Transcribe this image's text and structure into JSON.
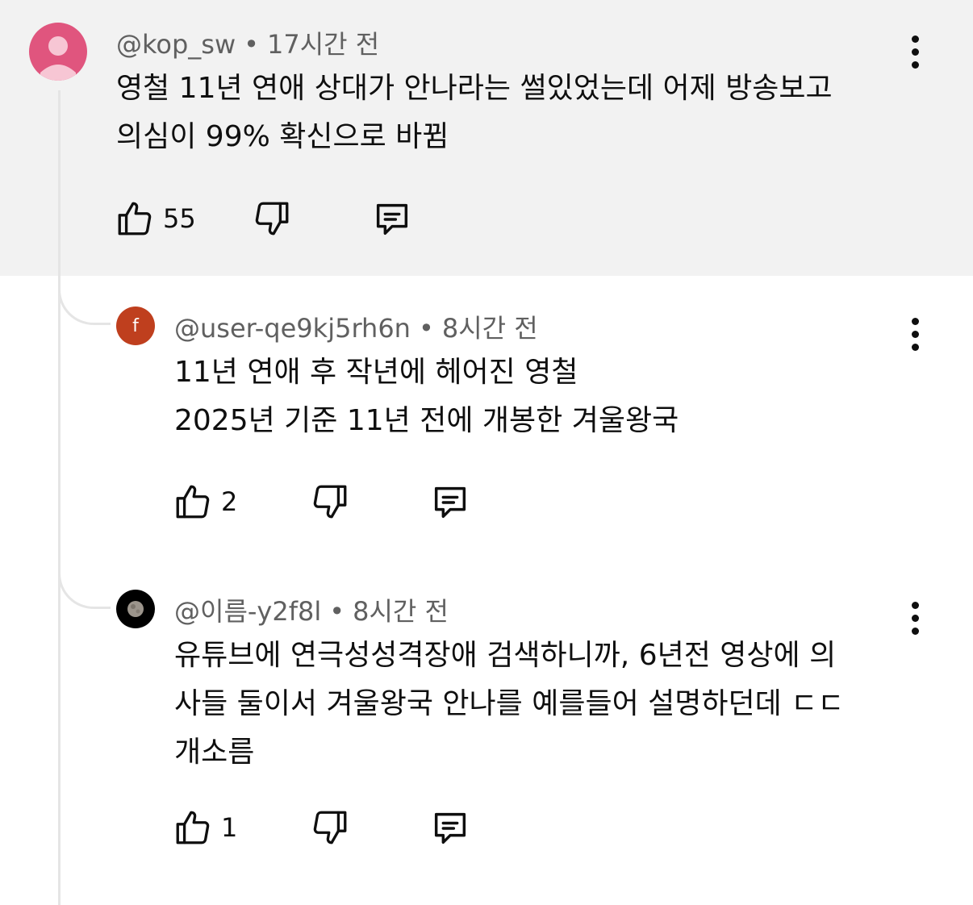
{
  "comments": [
    {
      "handle": "@kop_sw",
      "separator": "•",
      "time": "17시간 전",
      "lines": [
        "영철 11년 연애 상대가 안나라는 썰있었는데 어제 방송보고",
        "의심이 99% 확신으로 바뀜"
      ],
      "likes": "55"
    },
    {
      "avatar_letter": "f",
      "handle": "@user-qe9kj5rh6n",
      "separator": "•",
      "time": "8시간 전",
      "lines": [
        "11년 연애 후 작년에 헤어진 영철",
        "2025년 기준 11년 전에 개봉한 겨울왕국"
      ],
      "likes": "2"
    },
    {
      "handle": "@이름-y2f8l",
      "separator": "•",
      "time": "8시간 전",
      "lines": [
        "유튜브에 연극성성격장애 검색하니까, 6년전 영상에 의",
        "사들 둘이서 겨울왕국 안나를 예를들어 설명하던데 ㄷㄷ",
        "개소름"
      ],
      "likes": "1"
    }
  ],
  "icons": {
    "like": "thumbs-up-icon",
    "dislike": "thumbs-down-icon",
    "reply": "reply-comment-icon",
    "more": "more-vertical-icon"
  },
  "colors": {
    "highlight_bg": "#f2f2f2",
    "avatar_main": "#e0557e",
    "avatar_f": "#bf3f1e",
    "meta_text": "#606060"
  }
}
